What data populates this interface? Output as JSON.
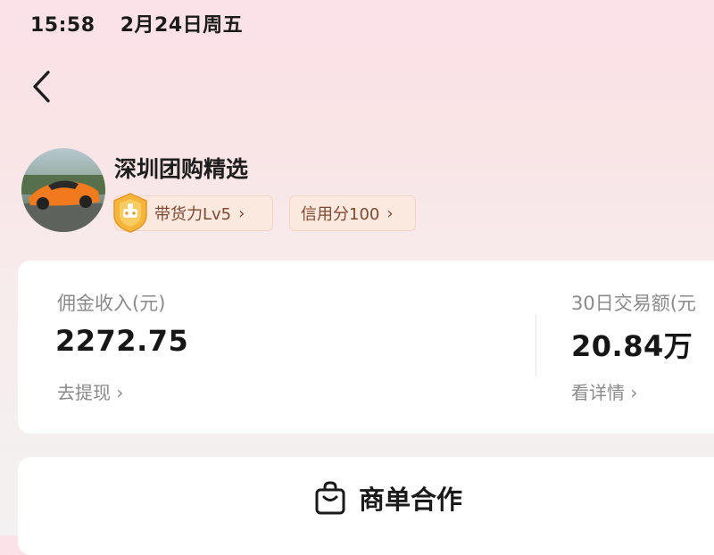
{
  "status_bar": {
    "time": "15:58",
    "date": "2月24日周五"
  },
  "shop": {
    "name": "深圳团购精选",
    "badges": [
      {
        "label": "带货力Lv5",
        "chevron": "›"
      },
      {
        "label": "信用分100",
        "chevron": "›"
      }
    ]
  },
  "stats": {
    "commission": {
      "label": "佣金收入(元)",
      "value": "2272.75",
      "link": "去提现 ›"
    },
    "trade": {
      "label": "30日交易额(元",
      "value": "20.84万",
      "link": "看详情 ›"
    }
  },
  "cooperation": {
    "label": "商单合作",
    "icon": "shopping-bag-icon"
  },
  "colors": {
    "accent_badge_bg": "#fbe8de",
    "badge_text": "#7c4a32",
    "medal_gold": "#f5b53a"
  }
}
